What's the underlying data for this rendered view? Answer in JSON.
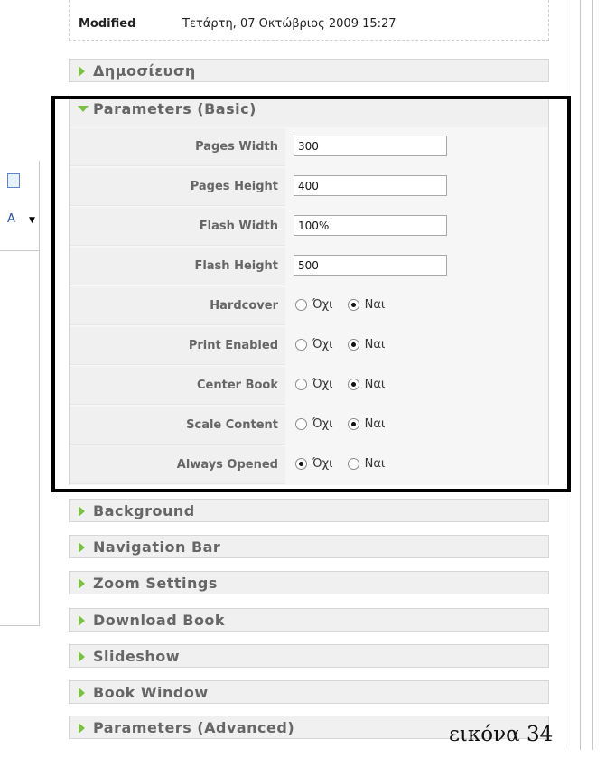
{
  "modified": {
    "label": "Modified",
    "value": "Τετάρτη, 07 Οκτώβριος 2009 15:27"
  },
  "panels_top": [
    {
      "label": "Δημοσίευση",
      "expanded": false
    }
  ],
  "parameters_basic": {
    "label": "Parameters (Basic)",
    "expanded": true,
    "text_fields": [
      {
        "key": "Pages Width",
        "value": "300"
      },
      {
        "key": "Pages Height",
        "value": "400"
      },
      {
        "key": "Flash Width",
        "value": "100%"
      },
      {
        "key": "Flash Height",
        "value": "500"
      }
    ],
    "radio_fields": [
      {
        "key": "Hardcover",
        "selected": "yes"
      },
      {
        "key": "Print Enabled",
        "selected": "yes"
      },
      {
        "key": "Center Book",
        "selected": "yes"
      },
      {
        "key": "Scale Content",
        "selected": "yes"
      },
      {
        "key": "Always Opened",
        "selected": "no"
      }
    ],
    "no_label": "Όχι",
    "yes_label": "Ναι"
  },
  "panels_bottom": [
    {
      "label": "Background"
    },
    {
      "label": "Navigation Bar"
    },
    {
      "label": "Zoom Settings"
    },
    {
      "label": "Download Book"
    },
    {
      "label": "Slideshow"
    },
    {
      "label": "Book Window"
    },
    {
      "label": "Parameters (Advanced)"
    }
  ],
  "caption": "εικόνα 34",
  "colors": {
    "accent_triangle": "#7bc043",
    "panel_bg": "#f0f0f0",
    "highlight_border": "#000000"
  }
}
